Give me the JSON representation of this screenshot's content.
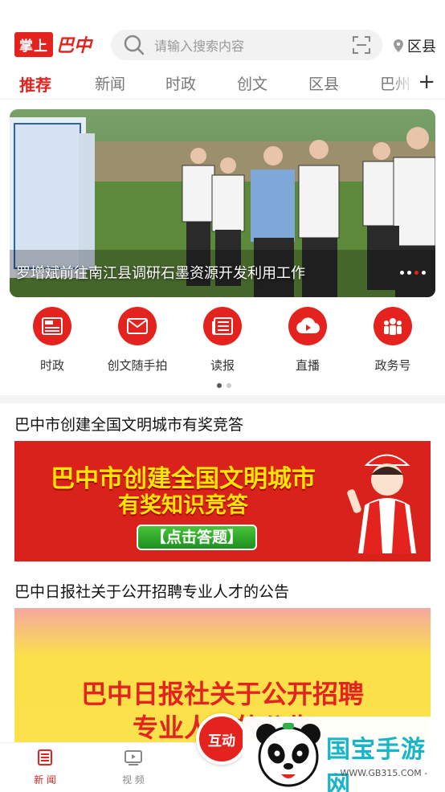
{
  "header": {
    "logo_box": "掌上",
    "logo_script": "巴中",
    "search_placeholder": "请输入搜索内容",
    "location": "区县"
  },
  "tabs": [
    {
      "label": "推荐",
      "active": true
    },
    {
      "label": "新闻"
    },
    {
      "label": "时政"
    },
    {
      "label": "创文"
    },
    {
      "label": "区县"
    },
    {
      "label": "巴州"
    }
  ],
  "tab_add": "+",
  "banner": {
    "caption": "罗增斌前往南江县调研石墨资源开发利用工作",
    "dots": 4,
    "active_dot": 3
  },
  "quick_links": [
    {
      "label": "时政",
      "icon": "news-paper-icon"
    },
    {
      "label": "创文随手拍",
      "icon": "mail-icon"
    },
    {
      "label": "读报",
      "icon": "newspaper-icon"
    },
    {
      "label": "直播",
      "icon": "cloud-play-icon"
    },
    {
      "label": "政务号",
      "icon": "people-icon"
    }
  ],
  "news": [
    {
      "title": "巴中市创建全国文明城市有奖竞答",
      "image_lines": [
        "巴中市创建全国文明城市",
        "有奖知识竞答"
      ],
      "image_button": "【点击答题】"
    },
    {
      "title": "巴中日报社关于公开招聘专业人才的公告",
      "image_lines": [
        "巴中日报社关于公开招聘",
        "专业人才的公告"
      ]
    }
  ],
  "bottom_nav": [
    {
      "label": "新 闻",
      "icon": "news-icon",
      "active": true
    },
    {
      "label": "视 频",
      "icon": "video-icon"
    }
  ],
  "center_button": "互动",
  "watermark": {
    "name": "国宝手游网",
    "url": "- WWW.GB315.COM -"
  },
  "colors": {
    "accent": "#e4231e",
    "watermark": "#18b4c8"
  }
}
